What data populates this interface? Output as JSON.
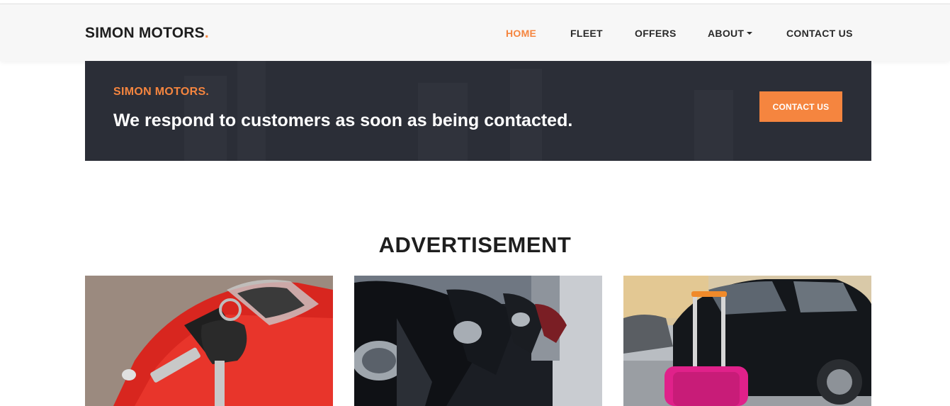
{
  "brand": {
    "name": "SIMON MOTORS",
    "dot": "."
  },
  "nav": {
    "items": [
      {
        "label": "HOME",
        "active": true
      },
      {
        "label": "FLEET",
        "active": false
      },
      {
        "label": "OFFERS",
        "active": false
      },
      {
        "label": "ABOUT",
        "active": false,
        "dropdown": true
      },
      {
        "label": "CONTACT US",
        "active": false
      }
    ]
  },
  "banner": {
    "kicker": "SIMON MOTORS.",
    "title": "We respond to customers as soon as being contacted.",
    "button_label": "CONTACT US"
  },
  "advertisement": {
    "heading": "ADVERTISEMENT",
    "cards": [
      {
        "image": "red-toy-car-with-keys"
      },
      {
        "image": "row-of-black-cars-headlights"
      },
      {
        "image": "black-car-with-pink-suitcase"
      }
    ]
  },
  "colors": {
    "accent": "#f5853f",
    "navbar_bg": "#f7f7f7",
    "banner_bg": "#2b2e37",
    "text_dark": "#1e1e1e"
  }
}
